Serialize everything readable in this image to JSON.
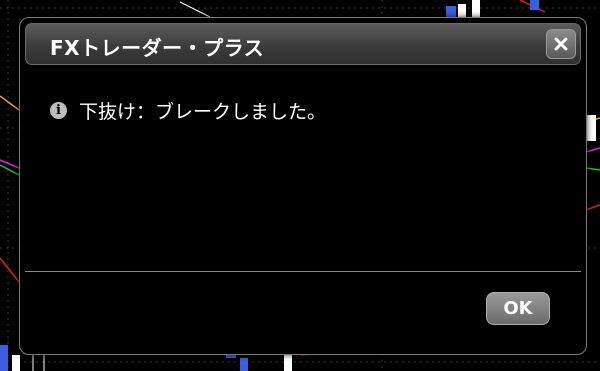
{
  "dialog": {
    "title": "FXトレーダー・プラス",
    "message": "下抜け：ブレークしました。",
    "ok_label": "OK",
    "info_icon_glyph": "i",
    "icons": {
      "info": "info-icon",
      "close": "close-icon"
    }
  },
  "colors": {
    "dialog_background": "#000000",
    "titlebar_top": "#5c5c5c",
    "titlebar_bottom": "#2f2f2f",
    "text": "#ffffff",
    "chart_up_candle": "#3b5fe0",
    "chart_line_red": "#e02020",
    "chart_line_magenta": "#e020e0",
    "chart_line_orange": "#f0a020",
    "chart_line_green": "#20c020"
  }
}
